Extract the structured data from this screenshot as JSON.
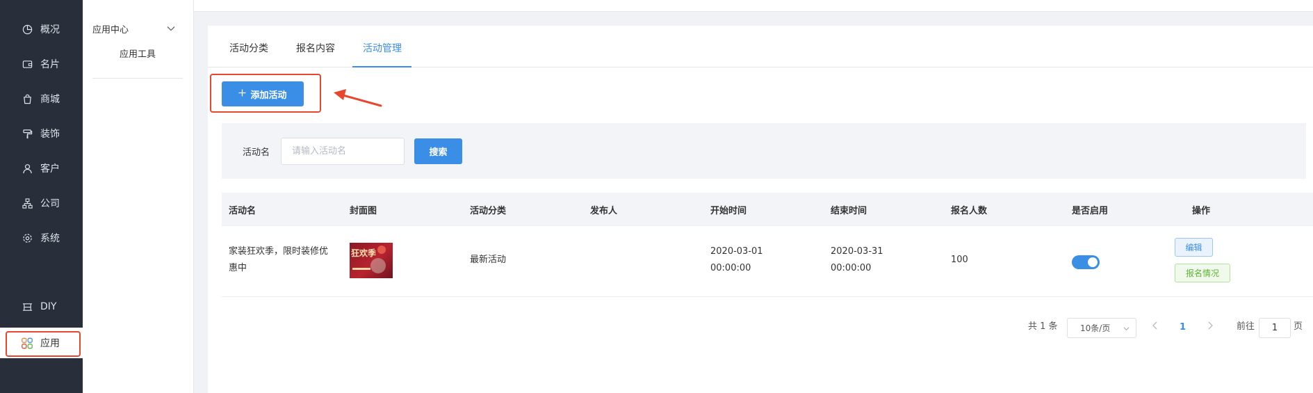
{
  "sidebar": {
    "items": [
      {
        "label": "概况",
        "icon": "pie-chart-icon"
      },
      {
        "label": "名片",
        "icon": "wallet-icon"
      },
      {
        "label": "商城",
        "icon": "shopping-bag-icon"
      },
      {
        "label": "装饰",
        "icon": "paint-roller-icon"
      },
      {
        "label": "客户",
        "icon": "user-icon"
      },
      {
        "label": "公司",
        "icon": "org-chart-icon"
      },
      {
        "label": "系统",
        "icon": "gear-icon"
      }
    ],
    "diy": {
      "label": "DIY",
      "icon": "diy-icon"
    },
    "app": {
      "label": "应用",
      "icon": "apps-grid-icon"
    }
  },
  "submenu": {
    "title": "应用中心",
    "item": "应用工具"
  },
  "tabs": [
    {
      "label": "活动分类",
      "active": false
    },
    {
      "label": "报名内容",
      "active": false
    },
    {
      "label": "活动管理",
      "active": true
    }
  ],
  "toolbar": {
    "add_label": "添加活动"
  },
  "filter": {
    "label": "活动名",
    "placeholder": "请输入活动名",
    "search_label": "搜索"
  },
  "table": {
    "columns": [
      "活动名",
      "封面图",
      "活动分类",
      "发布人",
      "开始时间",
      "结束时间",
      "报名人数",
      "是否启用",
      "操作"
    ],
    "rows": [
      {
        "name_line1": "家装狂欢季，限时装修优",
        "name_line2": "惠中",
        "cover_text": "狂欢季",
        "category": "最新活动",
        "publisher": "",
        "start_date": "2020-03-01",
        "start_time": "00:00:00",
        "end_date": "2020-03-31",
        "end_time": "00:00:00",
        "signups": "100",
        "enabled": true,
        "edit_label": "编辑",
        "signup_label": "报名情况"
      }
    ]
  },
  "pagination": {
    "total": "共 1 条",
    "page_size": "10条/页",
    "current_page": "1",
    "goto_label": "前往",
    "goto_value": "1",
    "page_unit": "页"
  },
  "colors": {
    "sidebar_bg": "#282e3a",
    "accent": "#3a8ee6",
    "highlight": "#e8472e",
    "success": "#5ab533"
  }
}
